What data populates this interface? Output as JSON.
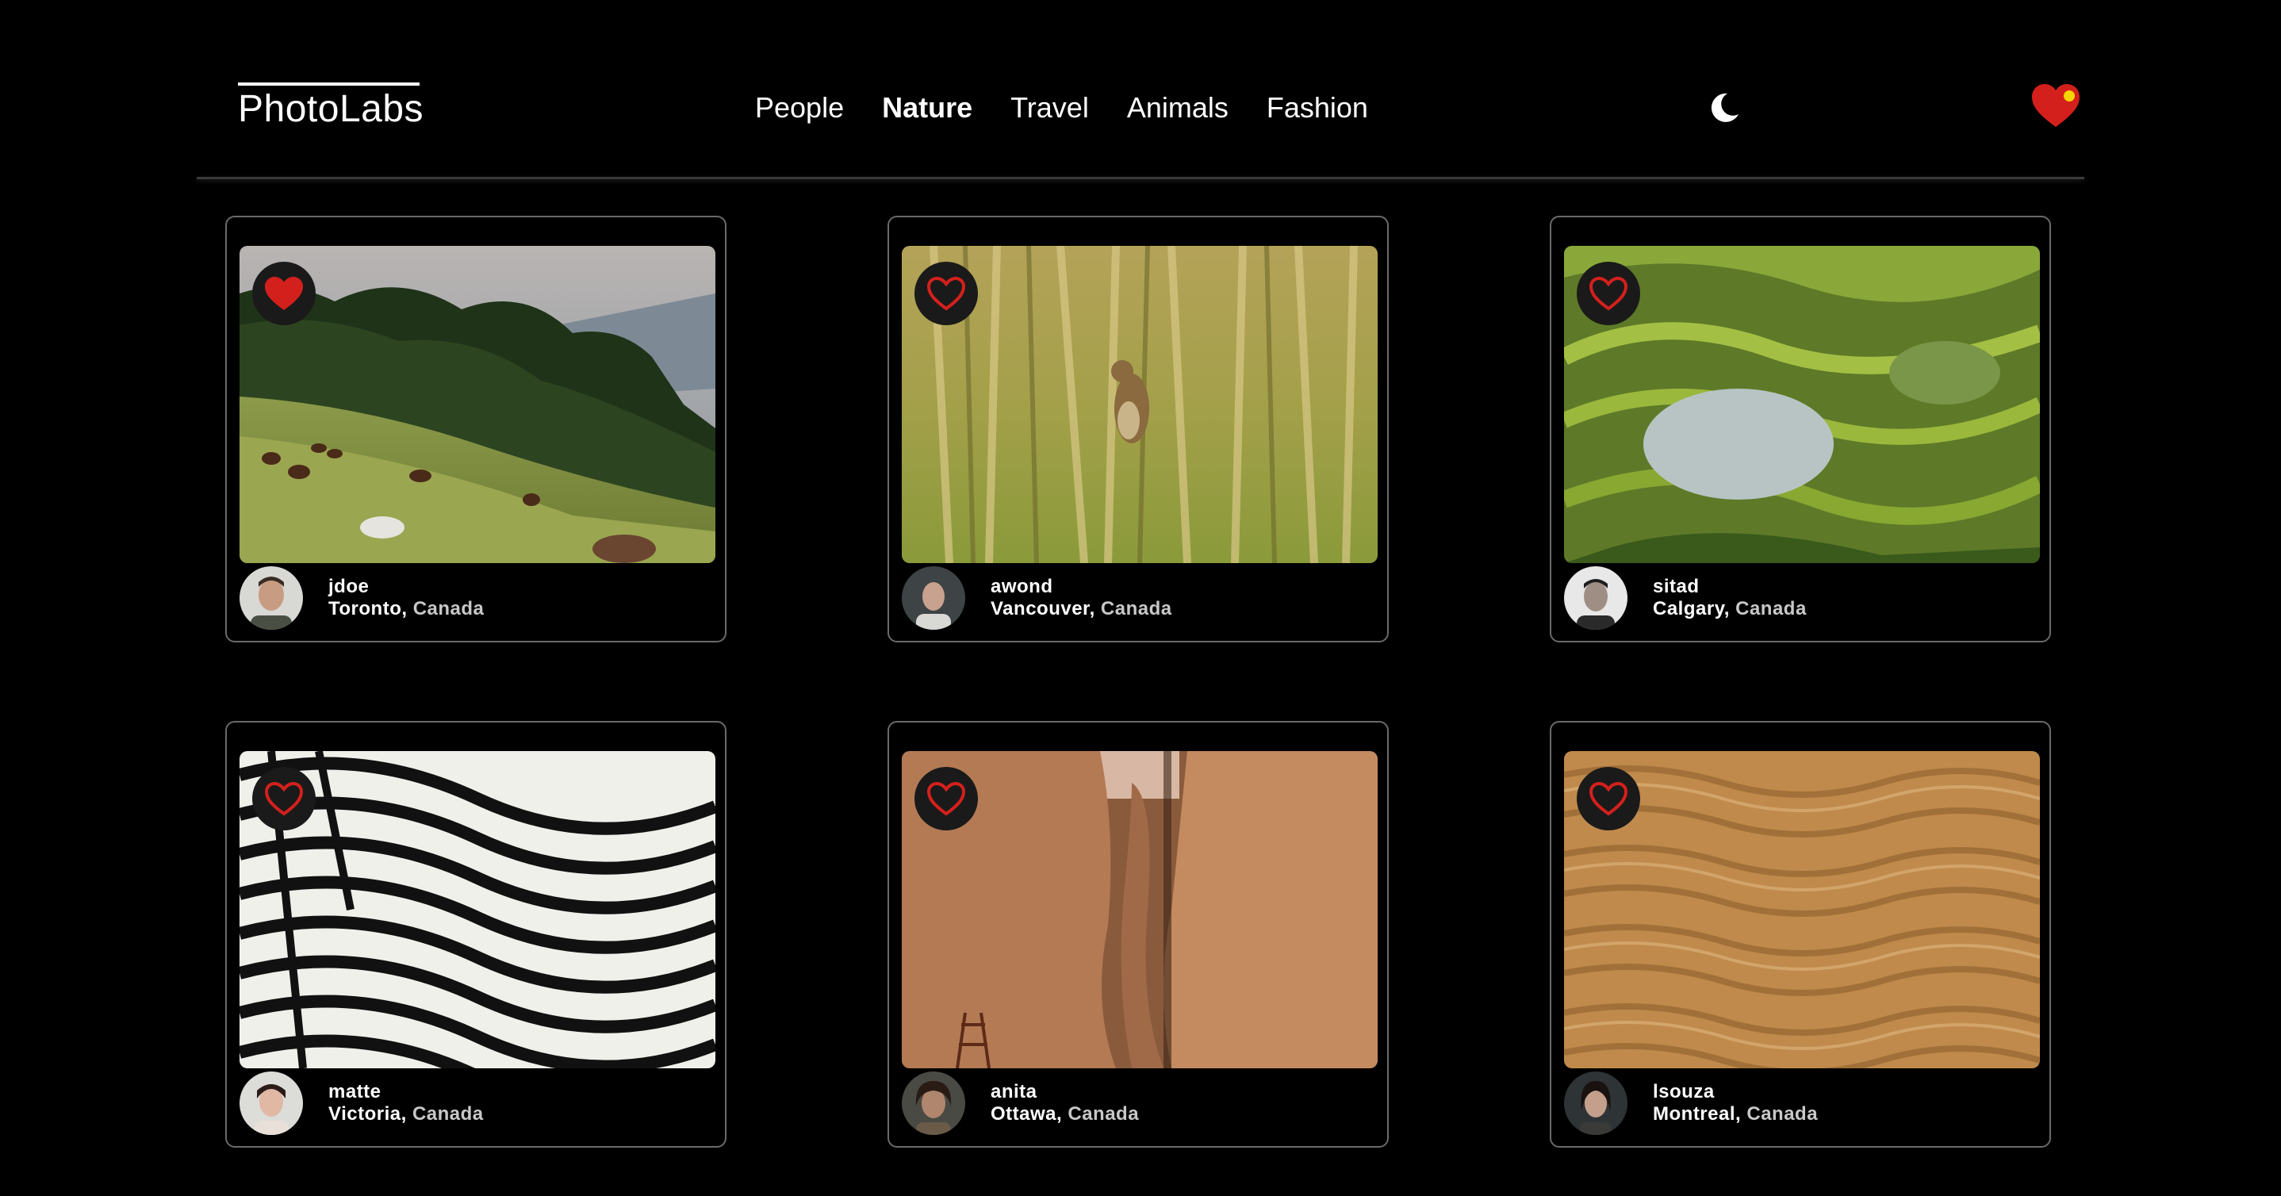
{
  "app": {
    "logo": "PhotoLabs",
    "nav": [
      "People",
      "Nature",
      "Travel",
      "Animals",
      "Fashion"
    ],
    "active_topic": "Nature",
    "accent_color": "#d4201c",
    "notification_color": "#f5d400"
  },
  "photos": [
    {
      "username": "jdoe",
      "city": "Toronto",
      "country": "Canada",
      "liked": true,
      "scene": "hills-with-horses"
    },
    {
      "username": "awond",
      "city": "Vancouver",
      "country": "Canada",
      "liked": false,
      "scene": "bird-in-reeds"
    },
    {
      "username": "sitad",
      "city": "Calgary",
      "country": "Canada",
      "liked": false,
      "scene": "rice-terraces"
    },
    {
      "username": "matte",
      "city": "Victoria",
      "country": "Canada",
      "liked": false,
      "scene": "zebra-stripes"
    },
    {
      "username": "anita",
      "city": "Ottawa",
      "country": "Canada",
      "liked": false,
      "scene": "canyon-rocks"
    },
    {
      "username": "lsouza",
      "city": "Montreal",
      "country": "Canada",
      "liked": false,
      "scene": "sand-dunes"
    }
  ]
}
